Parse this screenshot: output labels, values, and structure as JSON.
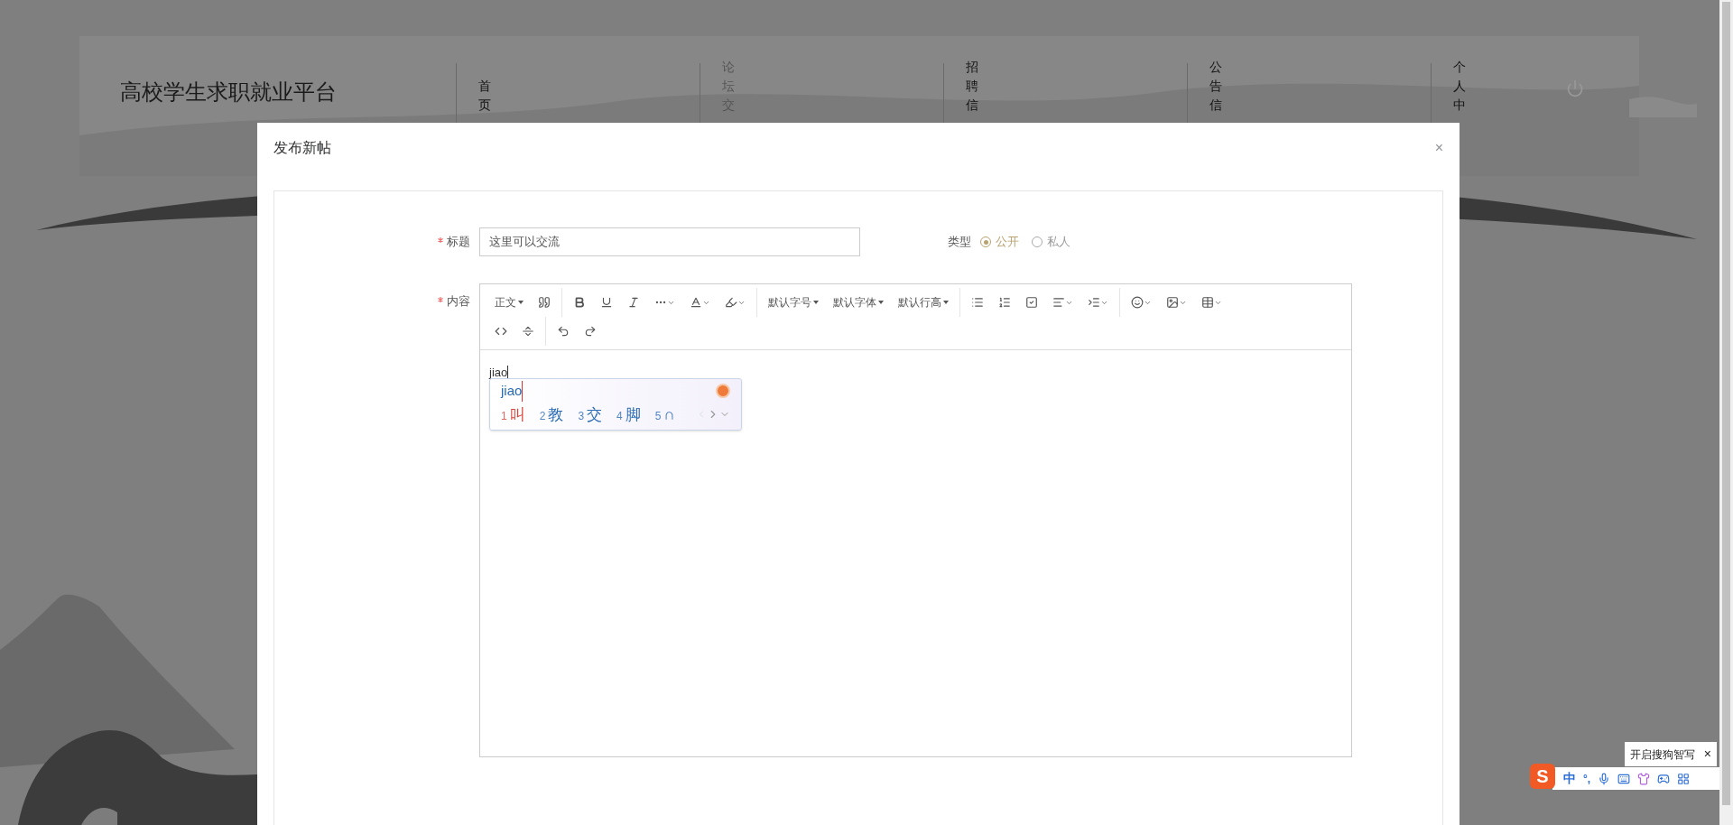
{
  "site_title": "高校学生求职就业平台",
  "nav": [
    {
      "label": "首页",
      "selected": false
    },
    {
      "label": "论坛交",
      "selected": true
    },
    {
      "label": "招聘信",
      "selected": false
    },
    {
      "label": "公告信",
      "selected": false
    },
    {
      "label": "个人中",
      "selected": false
    }
  ],
  "dialog": {
    "title": "发布新帖",
    "close": "×",
    "title_field": {
      "label": "标题",
      "required": true,
      "value": "这里可以交流"
    },
    "type_field": {
      "label": "类型",
      "options": [
        {
          "label": "公开",
          "selected": true
        },
        {
          "label": "私人",
          "selected": false
        }
      ]
    },
    "content_field": {
      "label": "内容",
      "required": true,
      "toolbar_labels": [
        "正文",
        "默认字号",
        "默认字体",
        "默认行高"
      ],
      "text": "jiao"
    }
  },
  "ime_popup": {
    "composition": "jiao",
    "candidates": [
      {
        "index": "1",
        "text": "叫",
        "selected": true
      },
      {
        "index": "2",
        "text": "教",
        "selected": false
      },
      {
        "index": "3",
        "text": "交",
        "selected": false
      },
      {
        "index": "4",
        "text": "脚",
        "selected": false
      },
      {
        "index": "5",
        "text": "∩",
        "selected": false
      }
    ]
  },
  "ime_bar": {
    "logo": "S",
    "mode": "中",
    "punctuation": "°,",
    "tooltip": "开启搜狗智写",
    "tooltip_close": "×"
  }
}
